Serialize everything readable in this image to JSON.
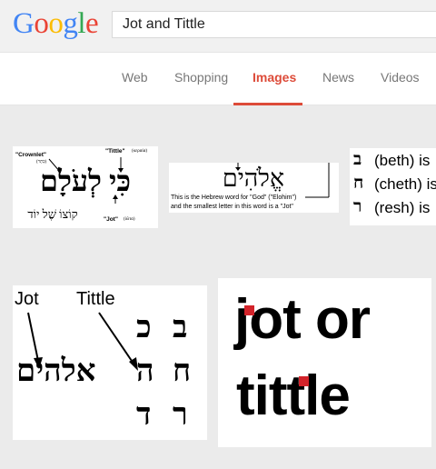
{
  "logo": {
    "letters": [
      "G",
      "o",
      "o",
      "g",
      "l",
      "e"
    ],
    "colors": [
      "#4285f4",
      "#ea4335",
      "#fbbc05",
      "#4285f4",
      "#34a853",
      "#ea4335"
    ]
  },
  "search": {
    "value": "Jot and Tittle"
  },
  "tabs": [
    {
      "label": "Web",
      "active": false
    },
    {
      "label": "Shopping",
      "active": false
    },
    {
      "label": "Images",
      "active": true
    },
    {
      "label": "News",
      "active": false
    },
    {
      "label": "Videos",
      "active": false
    }
  ],
  "accent_color": "#dd4b39",
  "results": {
    "r1": {
      "crownlet": "\"Crownlet\"",
      "crownlet_sub": "(כְּתָר)",
      "tittle": "\"Tittle\"",
      "tittle_sub": "(κεραία)",
      "jot": "\"Jot\"",
      "jot_sub": "(ἰῶτα)",
      "hebrew_big": "כִּי לְעֹלָם",
      "hebrew_small": "קוֹצוֹ שֶׁל יוֹד"
    },
    "r2": {
      "hebrew": "אֱלֹהִים",
      "caption1": "This is the Hebrew word for \"God\" (\"Elohim\")",
      "caption2": "and the smallest letter in this word is a \"Jot\""
    },
    "r3": {
      "lines": [
        {
          "letter": "ב",
          "text": "(beth) is"
        },
        {
          "letter": "ח",
          "text": "(cheth) is"
        },
        {
          "letter": "ר",
          "text": "(resh) is"
        }
      ]
    },
    "r4": {
      "jot": "Jot",
      "tittle": "Tittle",
      "word": "אלהים",
      "col1": [
        "כ",
        "ה",
        "ד"
      ],
      "col2": [
        "ב",
        "ח",
        "ר"
      ]
    },
    "r5": {
      "j": "j",
      "rest": "ot or",
      "tittle_prefix": "tittl",
      "tittle_suffix": "e",
      "red": "#d2232a"
    }
  }
}
